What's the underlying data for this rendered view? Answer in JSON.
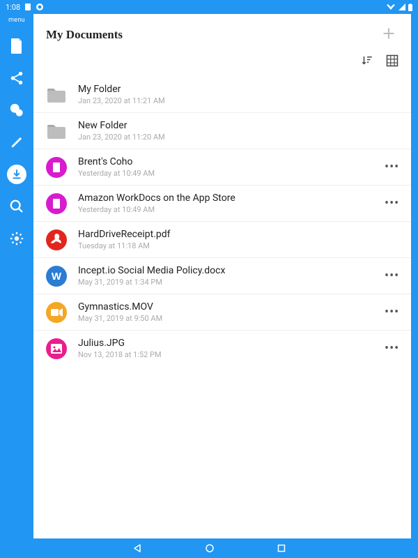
{
  "status": {
    "time": "1:08"
  },
  "sidebar": {
    "menu_label": "menu"
  },
  "header": {
    "title": "My Documents"
  },
  "items": [
    {
      "name": "My Folder",
      "meta": "Jan 23, 2020 at 11:21 AM",
      "type": "folder",
      "more": false
    },
    {
      "name": "New Folder",
      "meta": "Jan 23, 2020 at 11:20 AM",
      "type": "folder",
      "more": false
    },
    {
      "name": "Brent's Coho",
      "meta": "Yesterday at 10:49 AM",
      "type": "doc-magenta",
      "more": true
    },
    {
      "name": "Amazon WorkDocs on the App Store",
      "meta": "Yesterday at 10:49 AM",
      "type": "doc-magenta",
      "more": true
    },
    {
      "name": "HardDriveReceipt.pdf",
      "meta": "Tuesday at 11:18 AM",
      "type": "pdf",
      "more": false
    },
    {
      "name": "Incept.io Social Media Policy.docx",
      "meta": "May 31, 2019 at 1:34 PM",
      "type": "word",
      "more": true
    },
    {
      "name": "Gymnastics.MOV",
      "meta": "May 31, 2019 at 9:50 AM",
      "type": "video",
      "more": true
    },
    {
      "name": "Julius.JPG",
      "meta": "Nov 13, 2018 at 1:52 PM",
      "type": "image",
      "more": true
    }
  ],
  "colors": {
    "primary": "#2196F3",
    "folder": "#bdbdbd",
    "doc-magenta": "#D81BCE",
    "pdf": "#E1261D",
    "word": "#2B7CD3",
    "video": "#F5A623",
    "image": "#E91E8C"
  }
}
